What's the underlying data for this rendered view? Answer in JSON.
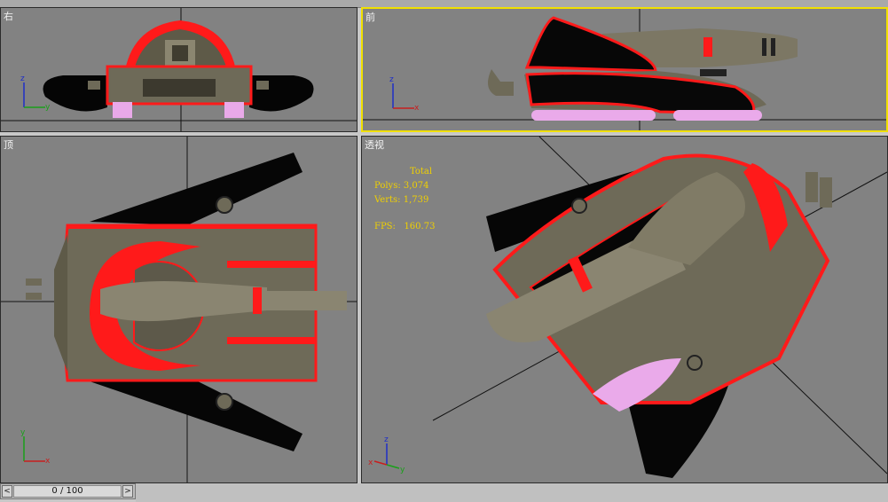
{
  "viewports": {
    "right": {
      "label": "右"
    },
    "front": {
      "label": "前"
    },
    "top": {
      "label": "顶"
    },
    "perspective": {
      "label": "透视"
    }
  },
  "stats": {
    "header": "Total",
    "polys_label": "Polys:",
    "polys_value": "3,074",
    "verts_label": "Verts:",
    "verts_value": "1,739",
    "fps_label": "FPS:",
    "fps_value": "160.73"
  },
  "timeslider": {
    "value": "0 / 100",
    "prev": "<",
    "next": ">"
  },
  "axis": {
    "x": "x",
    "y": "y",
    "z": "z"
  },
  "colors": {
    "viewport_bg": "#828282",
    "active_border": "#f0e000",
    "accent_red": "#ff1a1a",
    "model_body": "#6e6a58",
    "stats_text": "#f0d000"
  }
}
